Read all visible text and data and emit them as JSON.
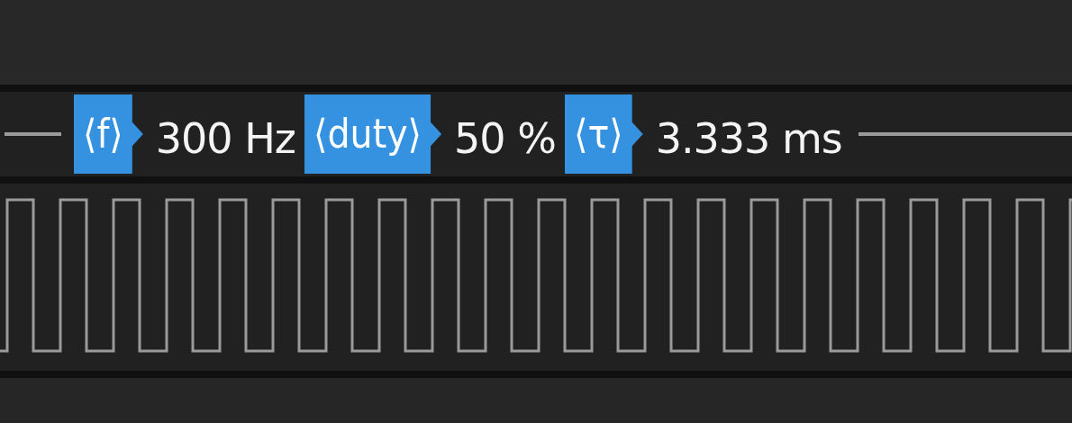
{
  "measurements": [
    {
      "tag": "⟨f⟩",
      "value": "300 Hz"
    },
    {
      "tag": "⟨duty⟩",
      "value": "50 %"
    },
    {
      "tag": "⟨τ⟩",
      "value": "3.333 ms"
    }
  ]
}
